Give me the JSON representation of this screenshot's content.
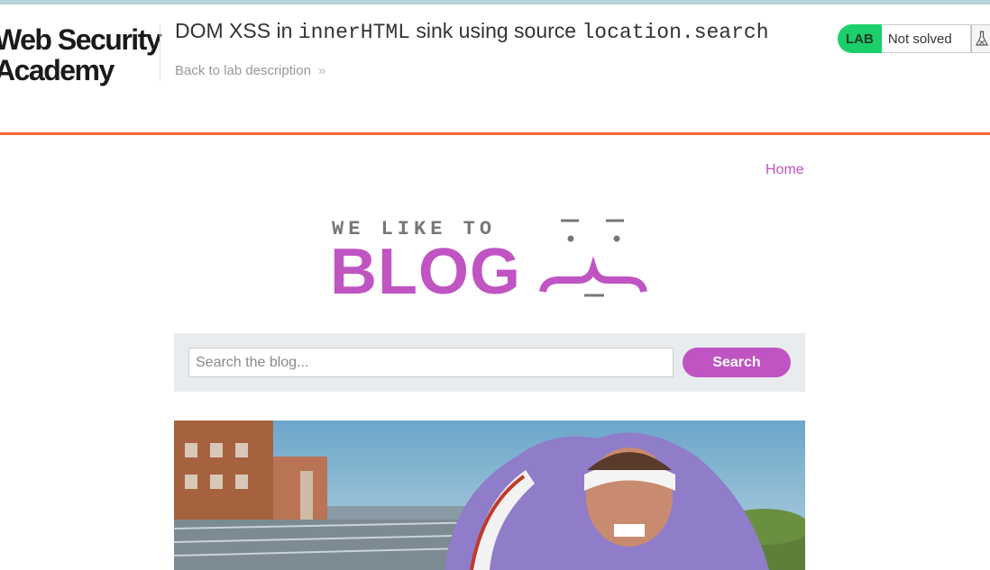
{
  "header": {
    "logo_line1": "Web Security",
    "logo_line2": "Academy",
    "title_prefix": "DOM XSS in ",
    "title_code1": "innerHTML",
    "title_middle": " sink using source ",
    "title_code2": "location.search",
    "back_link": "Back to lab description",
    "back_chevron": "»"
  },
  "status": {
    "label": "LAB",
    "state": "Not solved",
    "icon": "flask-icon",
    "color": "#1dcf6a"
  },
  "nav": {
    "home": "Home"
  },
  "banner": {
    "tagline": "WE LIKE TO",
    "word": "BLOG",
    "color": "#c054c3"
  },
  "search": {
    "placeholder": "Search the blog...",
    "value": "",
    "button": "Search"
  },
  "colors": {
    "accent": "#c054c3",
    "rule": "#ff6633"
  }
}
